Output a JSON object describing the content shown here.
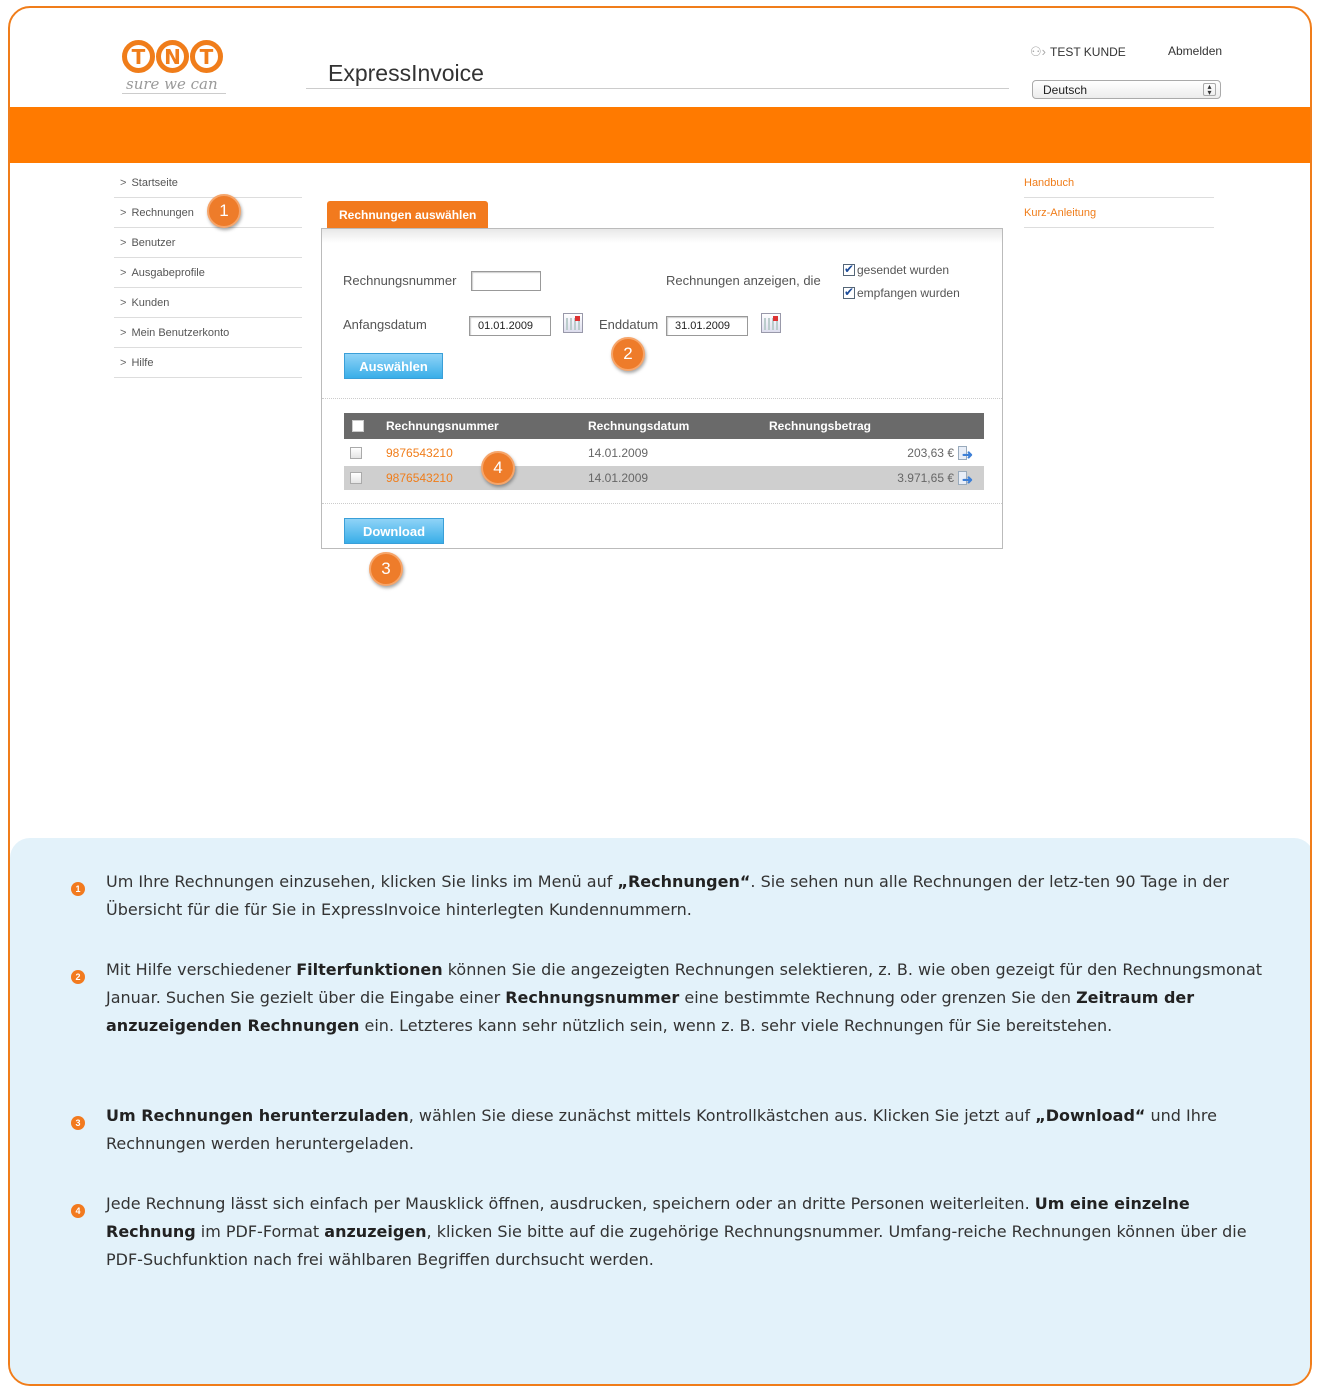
{
  "header": {
    "logo_letters": [
      "T",
      "N",
      "T"
    ],
    "slogan": "sure we can",
    "app_title": "ExpressInvoice",
    "user": "TEST KUNDE",
    "logout": "Abmelden",
    "language": "Deutsch"
  },
  "nav": {
    "items": [
      {
        "label": "Startseite"
      },
      {
        "label": "Rechnungen"
      },
      {
        "label": "Benutzer"
      },
      {
        "label": "Ausgabeprofile"
      },
      {
        "label": "Kunden"
      },
      {
        "label": "Mein Benutzerkonto"
      },
      {
        "label": "Hilfe"
      }
    ]
  },
  "help_links": [
    "Handbuch",
    "Kurz-Anleitung"
  ],
  "panel": {
    "tab": "Rechnungen auswählen",
    "invoice_number_label": "Rechnungsnummer",
    "invoice_number_value": "",
    "show_label": "Rechnungen anzeigen, die",
    "sent_label": "gesendet wurden",
    "received_label": "empfangen wurden",
    "start_label": "Anfangsdatum",
    "start_value": "01.01.2009",
    "end_label": "Enddatum",
    "end_value": "31.01.2009",
    "select_button": "Auswählen",
    "download_button": "Download"
  },
  "table": {
    "columns": [
      "Rechnungsnummer",
      "Rechnungsdatum",
      "Rechnungsbetrag"
    ],
    "rows": [
      {
        "number": "9876543210",
        "date": "14.01.2009",
        "amount": "203,63 €"
      },
      {
        "number": "9876543210",
        "date": "14.01.2009",
        "amount": "3.971,65 €"
      }
    ]
  },
  "badges": [
    "1",
    "2",
    "3",
    "4"
  ],
  "colors": {
    "accent": "#ff7a00",
    "button": "#39aee8",
    "info_bg": "#e3f2fa"
  },
  "instructions": [
    {
      "num": "1",
      "t1": "Um Ihre Rechnungen einzusehen, klicken Sie links im Menü auf ",
      "b1": "„Rechnungen“",
      "t2": ". Sie sehen nun alle Rechnungen der letz-ten 90 Tage in der Übersicht für die für Sie in ExpressInvoice hinterlegten Kundennummern."
    },
    {
      "num": "2",
      "t1": "Mit Hilfe verschiedener ",
      "b1": "Filterfunktionen",
      "t2": " können Sie die angezeigten Rechnungen selektieren, z. B. wie oben gezeigt für den Rechnungsmonat Januar. Suchen Sie gezielt über die Eingabe einer ",
      "b2": "Rechnungsnummer",
      "t3": " eine bestimmte Rechnung oder grenzen Sie den ",
      "b3": "Zeitraum der anzuzeigenden Rechnungen",
      "t4": " ein. Letzteres kann sehr nützlich sein, wenn z. B. sehr viele Rechnungen für Sie bereitstehen."
    },
    {
      "num": "3",
      "b1": "Um Rechnungen herunterzuladen",
      "t1": ", wählen Sie diese zunächst mittels Kontrollkästchen aus. Klicken Sie jetzt auf ",
      "b2": "„Download“",
      "t2": " und Ihre Rechnungen werden heruntergeladen."
    },
    {
      "num": "4",
      "t1": "Jede Rechnung lässt sich einfach per Mausklick öffnen, ausdrucken, speichern oder an dritte Personen weiterleiten. ",
      "b1": "Um eine einzelne Rechnung",
      "t2": " im PDF-Format ",
      "b2": "anzuzeigen",
      "t3": ", klicken Sie bitte auf die zugehörige Rechnungsnummer. Umfang-reiche Rechnungen können über die PDF-Suchfunktion nach frei wählbaren Begriffen durchsucht werden."
    }
  ]
}
